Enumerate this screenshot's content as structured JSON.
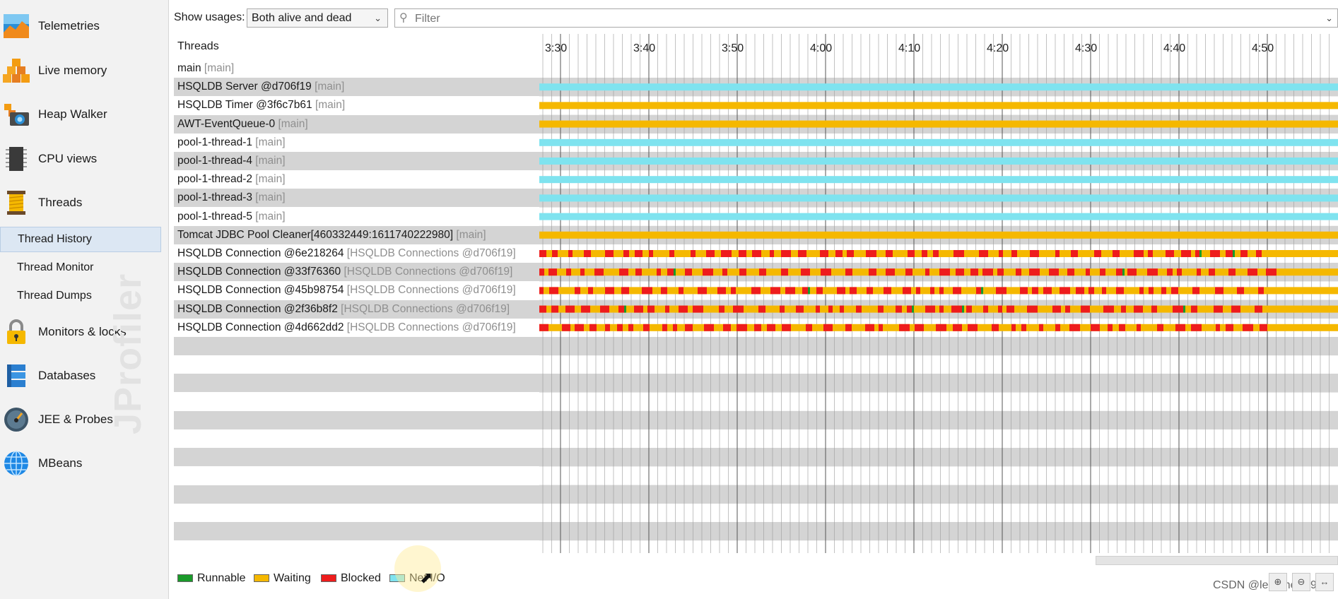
{
  "sidebar": {
    "items": [
      {
        "label": "Telemetries",
        "icon": "telemetries-icon",
        "name": "sidebar-item-telemetries"
      },
      {
        "label": "Live memory",
        "icon": "live-memory-icon",
        "name": "sidebar-item-live-memory"
      },
      {
        "label": "Heap Walker",
        "icon": "heap-walker-icon",
        "name": "sidebar-item-heap-walker"
      },
      {
        "label": "CPU views",
        "icon": "cpu-views-icon",
        "name": "sidebar-item-cpu-views"
      },
      {
        "label": "Threads",
        "icon": "threads-icon",
        "name": "sidebar-item-threads"
      },
      {
        "label": "Monitors & locks",
        "icon": "lock-icon",
        "name": "sidebar-item-monitors-locks"
      },
      {
        "label": "Databases",
        "icon": "database-icon",
        "name": "sidebar-item-databases"
      },
      {
        "label": "JEE & Probes",
        "icon": "gauge-icon",
        "name": "sidebar-item-jee-probes"
      },
      {
        "label": "MBeans",
        "icon": "globe-icon",
        "name": "sidebar-item-mbeans"
      }
    ],
    "subitems": [
      {
        "label": "Thread History",
        "selected": true,
        "name": "subitem-thread-history"
      },
      {
        "label": "Thread Monitor",
        "selected": false,
        "name": "subitem-thread-monitor"
      },
      {
        "label": "Thread Dumps",
        "selected": false,
        "name": "subitem-thread-dumps"
      }
    ],
    "brand": "JProfiler"
  },
  "toolbar": {
    "show_usages_label": "Show usages:",
    "show_usages_value": "Both alive and dead",
    "filter_placeholder": "Filter"
  },
  "table": {
    "header": "Threads",
    "time_ticks": [
      "3:30",
      "3:40",
      "3:50",
      "4:00",
      "4:10",
      "4:20",
      "4:30",
      "4:40",
      "4:50"
    ],
    "rows": [
      {
        "name": "main",
        "group": "[main]",
        "pattern": "none"
      },
      {
        "name": "HSQLDB Server @d706f19",
        "group": "[main]",
        "pattern": "netio"
      },
      {
        "name": "HSQLDB Timer @3f6c7b61",
        "group": "[main]",
        "pattern": "waiting"
      },
      {
        "name": "AWT-EventQueue-0",
        "group": "[main]",
        "pattern": "waiting"
      },
      {
        "name": "pool-1-thread-1",
        "group": "[main]",
        "pattern": "netio"
      },
      {
        "name": "pool-1-thread-4",
        "group": "[main]",
        "pattern": "netio"
      },
      {
        "name": "pool-1-thread-2",
        "group": "[main]",
        "pattern": "netio"
      },
      {
        "name": "pool-1-thread-3",
        "group": "[main]",
        "pattern": "netio"
      },
      {
        "name": "pool-1-thread-5",
        "group": "[main]",
        "pattern": "netio"
      },
      {
        "name": "Tomcat JDBC Pool Cleaner[460332449:1611740222980]",
        "group": "[main]",
        "pattern": "waiting"
      },
      {
        "name": "HSQLDB Connection @6e218264",
        "group": "[HSQLDB Connections @d706f19]",
        "pattern": "mixed"
      },
      {
        "name": "HSQLDB Connection @33f76360",
        "group": "[HSQLDB Connections @d706f19]",
        "pattern": "mixed"
      },
      {
        "name": "HSQLDB Connection @45b98754",
        "group": "[HSQLDB Connections @d706f19]",
        "pattern": "mixed"
      },
      {
        "name": "HSQLDB Connection @2f36b8f2",
        "group": "[HSQLDB Connections @d706f19]",
        "pattern": "mixed"
      },
      {
        "name": "HSQLDB Connection @4d662dd2",
        "group": "[HSQLDB Connections @d706f19]",
        "pattern": "mixed"
      }
    ]
  },
  "legend": [
    {
      "label": "Runnable",
      "color": "#1a9a2a"
    },
    {
      "label": "Waiting",
      "color": "#f5b800"
    },
    {
      "label": "Blocked",
      "color": "#ee1c1c"
    },
    {
      "label": "Net I/O",
      "color": "#7fe3ef"
    }
  ],
  "watermark": "CSDN @leo_messi94"
}
